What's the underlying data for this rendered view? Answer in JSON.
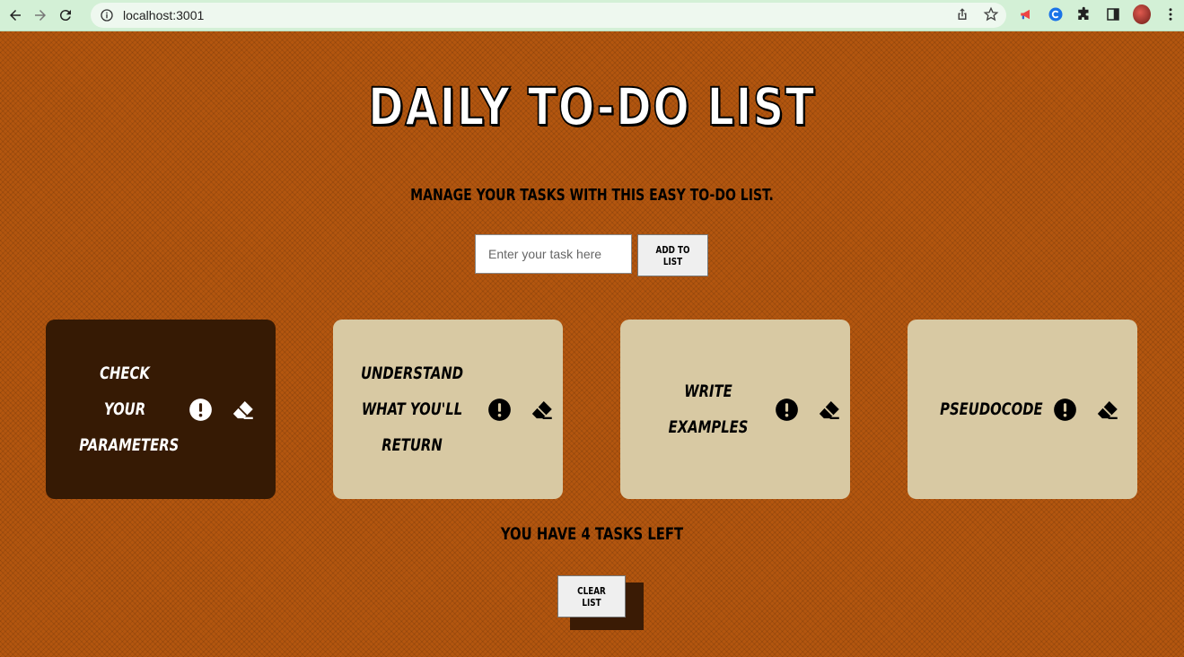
{
  "browser": {
    "url": "localhost:3001"
  },
  "app": {
    "title": "DAILY TO-DO LIST",
    "subtitle": "MANAGE YOUR TASKS WITH THIS EASY TO-DO LIST.",
    "input_placeholder": "Enter your task here",
    "input_value": "",
    "add_button_label": "ADD TO LIST",
    "tasks_left_text": "YOU HAVE 4 TASKS LEFT",
    "clear_button_label": "CLEAR LIST"
  },
  "tasks": [
    {
      "text": "CHECK YOUR PARAMETERS",
      "important": true
    },
    {
      "text": "UNDERSTAND WHAT YOU'LL RETURN",
      "important": false
    },
    {
      "text": "WRITE EXAMPLES",
      "important": false
    },
    {
      "text": "PSEUDOCODE",
      "important": false
    }
  ],
  "colors": {
    "page_background": "#b3560f",
    "card_default": "#d8c9a3",
    "card_important": "#361a04",
    "button_background": "#efefef"
  },
  "icons": {
    "important": "exclamation-circle-icon",
    "delete": "eraser-icon"
  }
}
